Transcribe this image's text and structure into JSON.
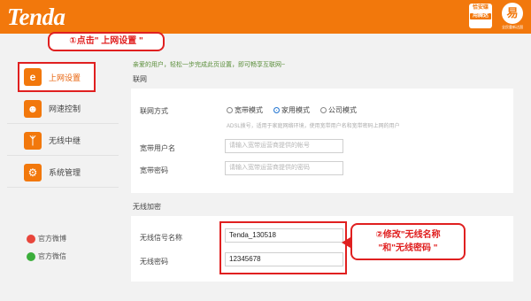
{
  "header": {
    "logo": "Tenda",
    "badge_line1": "恰安碟",
    "badge_line2": "用腾达",
    "brand_char": "易",
    "brand_sub": "全民重新达国"
  },
  "sidebar": {
    "items": [
      {
        "label": "上网设置",
        "icon": "e-icon"
      },
      {
        "label": "网速控制",
        "icon": "users-icon"
      },
      {
        "label": "无线中继",
        "icon": "relay-icon"
      },
      {
        "label": "系统管理",
        "icon": "gear-icon"
      }
    ],
    "social": [
      {
        "label": "官方微博",
        "icon": "weibo-icon",
        "color": "#e8463c"
      },
      {
        "label": "官方微信",
        "icon": "wechat-icon",
        "color": "#3bae3b"
      }
    ]
  },
  "callouts": {
    "step1": "①点击\" 上网设置 \"",
    "step2_line1": "②修改\"无线名称",
    "step2_line2": "\"和\"无线密码 \""
  },
  "main": {
    "intro": "亲爱的用户，轻松一步完成此页设置，即可畅享互联网~",
    "net_section": "联网",
    "conn_label": "联网方式",
    "modes": [
      "宽带模式",
      "家用模式",
      "公司模式"
    ],
    "mode_selected": 1,
    "adsl_note": "ADSL拨号，适用于家庭网络环境，使用宽带用户名和宽带密码上网的用户",
    "user_label": "宽带用户名",
    "user_placeholder": "请输入宽带运营商提供的帐号",
    "pass_label": "宽带密码",
    "pass_placeholder": "请输入宽带运营商提供的密码",
    "wireless_section": "无线加密",
    "ssid_label": "无线信号名称",
    "ssid_value": "Tenda_130518",
    "wpass_label": "无线密码",
    "wpass_value": "12345678"
  },
  "colors": {
    "accent": "#f2780c",
    "highlight": "#e02020",
    "radio_on": "#2b7bd3"
  }
}
